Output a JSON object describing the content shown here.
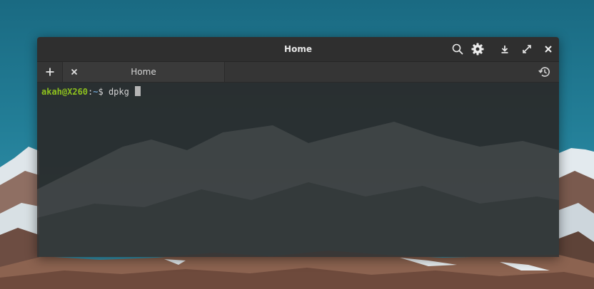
{
  "window": {
    "title": "Home",
    "header_icons": [
      "search-icon",
      "gear-icon",
      "download-icon",
      "fullscreen-icon",
      "close-icon"
    ]
  },
  "tabs": [
    {
      "label": "Home",
      "active": true
    }
  ],
  "tab_bar_icons": [
    "plus-icon",
    "close-icon",
    "history-icon"
  ],
  "terminal": {
    "prompt_user": "akah@X260",
    "prompt_sep": ":",
    "prompt_path": "~",
    "prompt_symbol": "$",
    "command": " dpkg "
  },
  "colors": {
    "prompt_user": "#8ec21e",
    "prompt_path": "#6c9fc9",
    "terminal_bg": "#2a2a2a",
    "titlebar_bg": "#2f2f2f"
  }
}
